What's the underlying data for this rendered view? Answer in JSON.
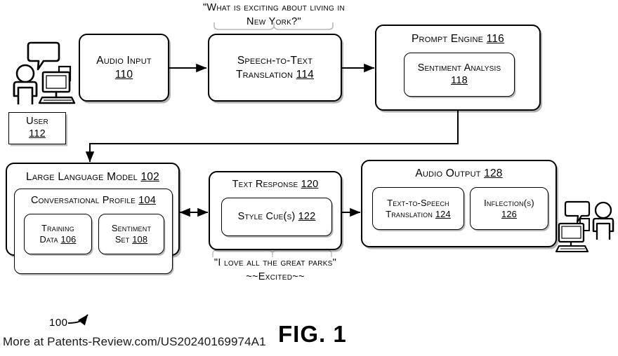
{
  "figure": {
    "label": "FIG. 1",
    "reference_numeral": "100",
    "footer": "More at Patents-Review.com/US20240169974A1"
  },
  "callouts": {
    "user_question": "\"What is exciting about living in\nNew York?\"",
    "response_quote": "\"I love all the great parks\"\n~~Excited~~"
  },
  "icons": {
    "user_left": "person-with-speech-bubble-and-computer-icon",
    "user_right": "computer-with-speech-bubble-and-person-icon"
  },
  "blocks": {
    "user": {
      "title": "User",
      "num": "112"
    },
    "audio_input": {
      "title": "Audio Input",
      "num": "110"
    },
    "speech_to_text": {
      "title": "Speech-to-Text",
      "title2": "Translation",
      "num": "114"
    },
    "prompt_engine": {
      "title": "Prompt Engine",
      "num": "116",
      "child": {
        "title": "Sentiment Analysis",
        "num": "118"
      }
    },
    "llm": {
      "title": "Large Language Model",
      "num": "102",
      "profile": {
        "title": "Conversational Profile",
        "num": "104",
        "children": [
          {
            "title": "Training",
            "title2": "Data",
            "num": "106"
          },
          {
            "title": "Sentiment",
            "title2": "Set",
            "num": "108"
          }
        ]
      }
    },
    "text_response": {
      "title": "Text Response",
      "num": "120",
      "child": {
        "title": "Style Cue(s)",
        "num": "122"
      }
    },
    "audio_output": {
      "title": "Audio Output",
      "num": "128",
      "children": [
        {
          "title": "Text-to-Speech",
          "title2": "Translation",
          "num": "124"
        },
        {
          "title": "Inflection(s)",
          "num": "126"
        }
      ]
    }
  }
}
